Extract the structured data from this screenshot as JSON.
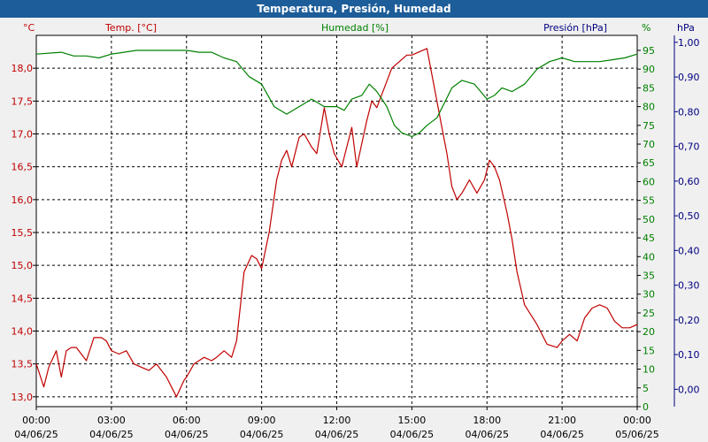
{
  "chart_data": {
    "type": "line",
    "title": "Temperatura, Presión, Humedad",
    "grid": true,
    "x": {
      "range_hours": [
        0,
        24
      ],
      "ticks": [
        {
          "h": 0,
          "time": "00:00",
          "date": "04/06/25"
        },
        {
          "h": 3,
          "time": "03:00",
          "date": "04/06/25"
        },
        {
          "h": 6,
          "time": "06:00",
          "date": "04/06/25"
        },
        {
          "h": 9,
          "time": "09:00",
          "date": "04/06/25"
        },
        {
          "h": 12,
          "time": "12:00",
          "date": "04/06/25"
        },
        {
          "h": 15,
          "time": "15:00",
          "date": "04/06/25"
        },
        {
          "h": 18,
          "time": "18:00",
          "date": "04/06/25"
        },
        {
          "h": 21,
          "time": "21:00",
          "date": "04/06/25"
        },
        {
          "h": 24,
          "time": "00:00",
          "date": "05/06/25"
        }
      ]
    },
    "axes": {
      "temp": {
        "label": "Temp. [°C]",
        "unit": "°C",
        "range": [
          12.85,
          18.5
        ],
        "ticks": [
          "13,0",
          "13,5",
          "14,0",
          "14,5",
          "15,0",
          "15,5",
          "16,0",
          "16,5",
          "17,0",
          "17,5",
          "18,0"
        ],
        "tick_values": [
          13,
          13.5,
          14,
          14.5,
          15,
          15.5,
          16,
          16.5,
          17,
          17.5,
          18
        ],
        "color": "#c00000"
      },
      "humidity": {
        "label": "Humedad [%]",
        "unit": "%",
        "range": [
          0,
          99
        ],
        "ticks": [
          "0",
          "5",
          "10",
          "15",
          "20",
          "25",
          "30",
          "35",
          "40",
          "45",
          "50",
          "55",
          "60",
          "65",
          "70",
          "75",
          "80",
          "85",
          "90",
          "95"
        ],
        "tick_values": [
          0,
          5,
          10,
          15,
          20,
          25,
          30,
          35,
          40,
          45,
          50,
          55,
          60,
          65,
          70,
          75,
          80,
          85,
          90,
          95
        ],
        "color": "#008000"
      },
      "pressure": {
        "label": "Presión [hPa]",
        "unit": "hPa",
        "range": [
          -0.05,
          1.02
        ],
        "ticks": [
          "0,00",
          "0,10",
          "0,20",
          "0,30",
          "0,40",
          "0,50",
          "0,60",
          "0,70",
          "0,80",
          "0,90",
          "1,00"
        ],
        "tick_values": [
          0,
          0.1,
          0.2,
          0.3,
          0.4,
          0.5,
          0.6,
          0.7,
          0.8,
          0.9,
          1.0
        ],
        "color": "#000080"
      }
    },
    "series": [
      {
        "name": "Temp. [°C]",
        "axis": "temp",
        "color": "#c00000",
        "x": [
          0,
          0.3,
          0.5,
          0.8,
          1.0,
          1.2,
          1.4,
          1.6,
          2.0,
          2.3,
          2.6,
          2.8,
          3.0,
          3.3,
          3.6,
          3.9,
          4.2,
          4.5,
          4.8,
          5.2,
          5.6,
          5.9,
          6.0,
          6.3,
          6.7,
          7.0,
          7.2,
          7.5,
          7.8,
          8.0,
          8.3,
          8.6,
          8.8,
          9.0,
          9.3,
          9.6,
          9.8,
          10.0,
          10.2,
          10.4,
          10.5,
          10.7,
          11.0,
          11.2,
          11.5,
          11.7,
          11.9,
          12.2,
          12.4,
          12.6,
          12.8,
          13.2,
          13.4,
          13.6,
          13.8,
          14.2,
          14.5,
          14.8,
          15.0,
          15.3,
          15.6,
          16.0,
          16.2,
          16.4,
          16.6,
          16.8,
          17.0,
          17.3,
          17.6,
          17.9,
          18.1,
          18.3,
          18.5,
          18.8,
          19.0,
          19.2,
          19.5,
          20.0,
          20.4,
          20.8,
          21.0,
          21.3,
          21.6,
          21.9,
          22.2,
          22.5,
          22.8,
          23.1,
          23.4,
          23.7,
          24.0
        ],
        "y": [
          13.5,
          13.15,
          13.45,
          13.7,
          13.3,
          13.7,
          13.75,
          13.75,
          13.55,
          13.9,
          13.9,
          13.85,
          13.7,
          13.65,
          13.7,
          13.5,
          13.45,
          13.4,
          13.5,
          13.3,
          13.0,
          13.25,
          13.3,
          13.5,
          13.6,
          13.55,
          13.6,
          13.7,
          13.6,
          13.85,
          14.9,
          15.15,
          15.1,
          14.95,
          15.5,
          16.3,
          16.6,
          16.75,
          16.5,
          16.8,
          16.95,
          17.0,
          16.8,
          16.7,
          17.4,
          17.0,
          16.7,
          16.5,
          16.8,
          17.1,
          16.5,
          17.2,
          17.5,
          17.4,
          17.6,
          18.0,
          18.1,
          18.2,
          18.2,
          18.25,
          18.3,
          17.5,
          17.1,
          16.7,
          16.2,
          16.0,
          16.1,
          16.3,
          16.1,
          16.3,
          16.6,
          16.5,
          16.3,
          15.8,
          15.4,
          14.9,
          14.4,
          14.1,
          13.8,
          13.75,
          13.85,
          13.95,
          13.85,
          14.2,
          14.35,
          14.4,
          14.35,
          14.15,
          14.05,
          14.05,
          14.1
        ]
      },
      {
        "name": "Humedad [%]",
        "axis": "humidity",
        "color": "#008000",
        "x": [
          0,
          1.0,
          1.5,
          2.0,
          2.5,
          3.0,
          3.5,
          4.0,
          5.0,
          6.0,
          6.5,
          7.0,
          7.5,
          8.0,
          8.5,
          9.0,
          9.5,
          10.0,
          10.5,
          11.0,
          11.5,
          12.0,
          12.3,
          12.6,
          13.0,
          13.3,
          13.6,
          14.0,
          14.3,
          14.6,
          15.0,
          15.3,
          15.6,
          16.0,
          16.3,
          16.6,
          17.0,
          17.5,
          18.0,
          18.3,
          18.6,
          19.0,
          19.5,
          20.0,
          20.5,
          21.0,
          21.5,
          22.0,
          22.5,
          23.0,
          23.5,
          24.0
        ],
        "y": [
          94,
          94.5,
          93.5,
          93.5,
          93,
          94,
          94.5,
          95,
          95,
          95,
          94.5,
          94.5,
          93,
          92,
          88,
          86,
          80,
          78,
          80,
          82,
          80,
          80,
          79,
          82,
          83,
          86,
          84,
          80,
          75,
          73,
          72,
          73,
          75,
          77,
          81,
          85,
          87,
          86,
          82,
          83,
          85,
          84,
          86,
          90,
          92,
          93,
          92,
          92,
          92,
          92.5,
          93,
          94
        ]
      }
    ]
  }
}
